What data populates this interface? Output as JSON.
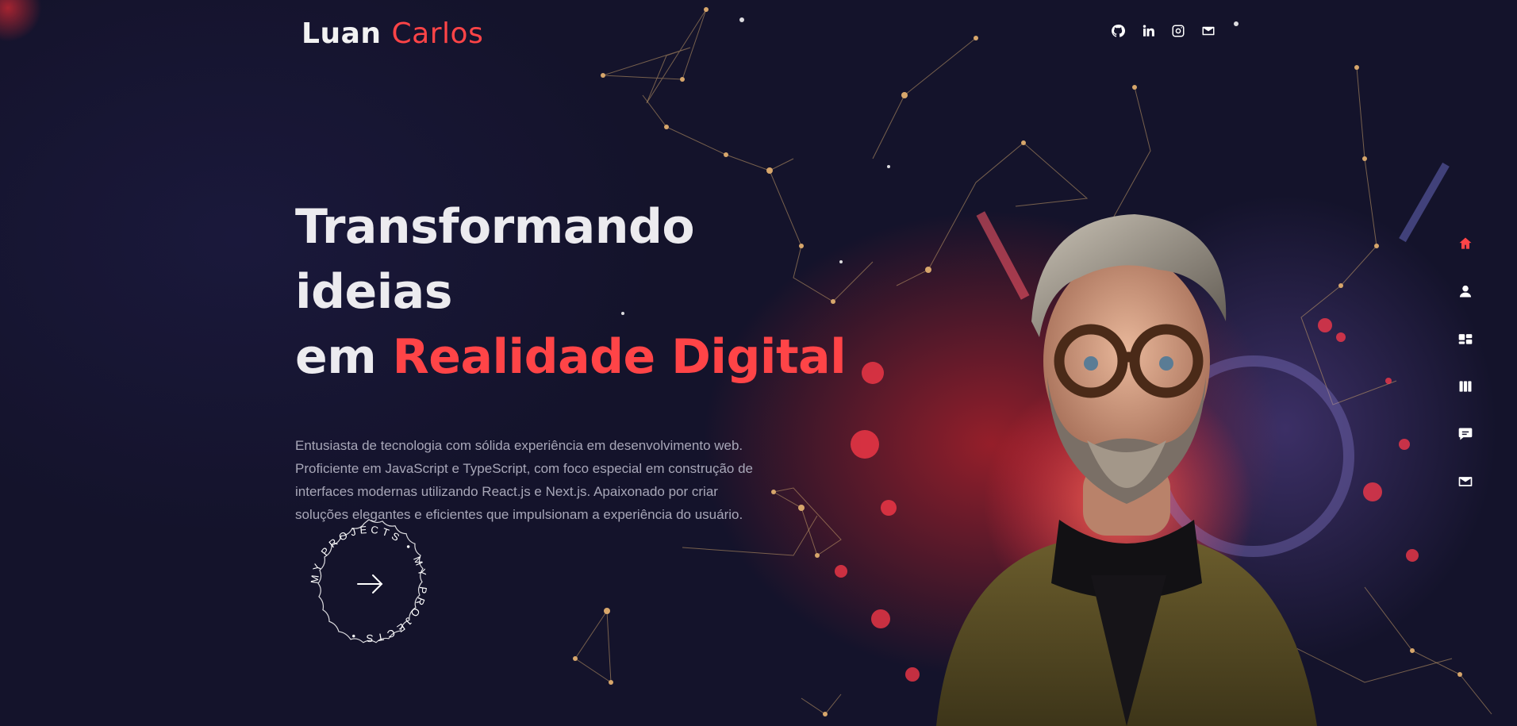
{
  "brand": {
    "first_name": "Luan",
    "last_name": "Carlos",
    "accent_color": "#ff4447"
  },
  "socials": [
    {
      "icon": "github-icon"
    },
    {
      "icon": "linkedin-icon"
    },
    {
      "icon": "instagram-icon"
    },
    {
      "icon": "mail-icon"
    }
  ],
  "hero": {
    "title_line1": "Transformando ideias",
    "title_line2_prefix": "em ",
    "title_line2_accent": "Realidade Digital",
    "description": "Entusiasta de tecnologia com sólida experiência em desenvolvimento web. Proficiente em JavaScript e TypeScript, com foco especial em construção de interfaces modernas utilizando React.js e Next.js. Apaixonado por criar soluções elegantes e eficientes que impulsionam a experiência do usuário."
  },
  "cta": {
    "circular_text": "MY PROJECTS • MY PROJECTS • ",
    "icon": "arrow-right-icon"
  },
  "side_nav": [
    {
      "icon": "home-icon",
      "active": true
    },
    {
      "icon": "user-icon",
      "active": false
    },
    {
      "icon": "services-icon",
      "active": false
    },
    {
      "icon": "portfolio-icon",
      "active": false
    },
    {
      "icon": "testimonials-icon",
      "active": false
    },
    {
      "icon": "contact-mail-icon",
      "active": false
    }
  ],
  "colors": {
    "background": "#14132b",
    "accent": "#ff4447",
    "text_muted": "#a8a7b8"
  }
}
